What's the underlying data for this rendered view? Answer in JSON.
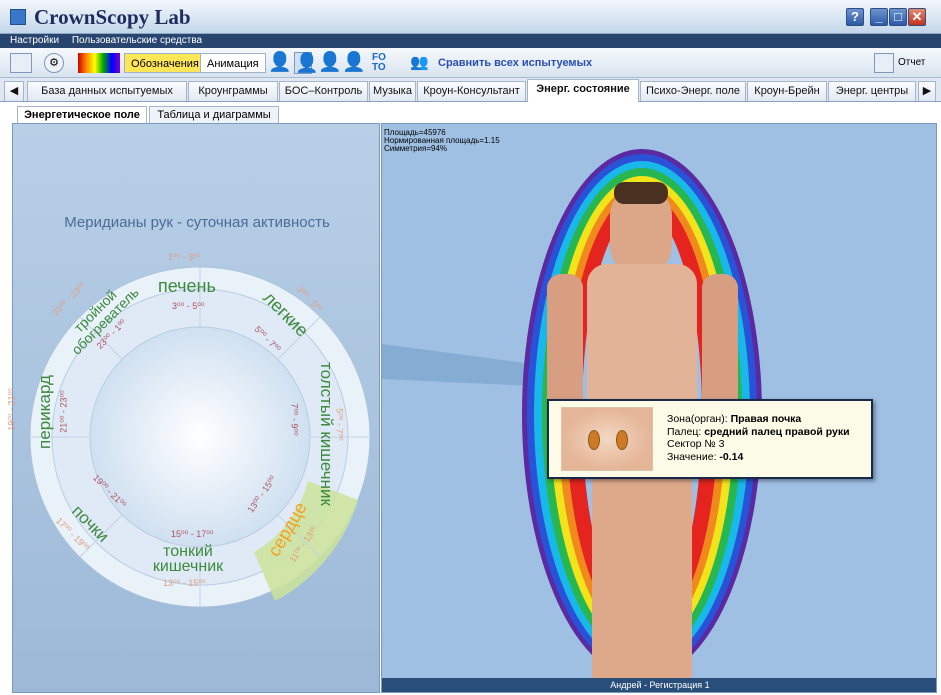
{
  "app": {
    "title": "CrownScopy Lab",
    "help": "?",
    "minimize": "_",
    "restore": "□",
    "close": "✕"
  },
  "menu": {
    "items": [
      "Настройки",
      "Пользовательские средства"
    ]
  },
  "toolbar": {
    "designations": "Обозначения",
    "animation": "Анимация",
    "foto": "FO\nTO",
    "compare": "Сравнить всех испытуемых",
    "report": "Отчет"
  },
  "tabs": [
    "База данных испытуемых",
    "Кроунграммы",
    "БОС–Контроль",
    "Музыка",
    "Кроун-Консультант",
    "Энерг. состояние",
    "Психо-Энерг. поле",
    "Кроун-Брейн",
    "Энерг. центры"
  ],
  "subtabs": [
    "Энергетическое поле",
    "Таблица и диаграммы"
  ],
  "left": {
    "title": "Меридианы рук - суточная активность"
  },
  "wheel": {
    "organs": [
      {
        "label": "печень",
        "time": "1⁰⁰ - 3⁰⁰",
        "inner": "3⁰⁰ - 5⁰⁰"
      },
      {
        "label": "легкие",
        "time": "3⁰⁰ - 5⁰⁰",
        "inner": "5⁰⁰ - 7⁰⁰"
      },
      {
        "label": "толстый кишечник",
        "time": "5⁰⁰ - 7⁰⁰",
        "inner": "7⁰⁰ - 9⁰⁰"
      },
      {
        "label": "сердце",
        "time": "11⁰⁰ - 13⁰⁰",
        "inner": "13⁰⁰ - 15⁰⁰"
      },
      {
        "label": "тонкий кишечник",
        "time": "13⁰⁰ - 15⁰⁰",
        "inner": "15⁰⁰ - 17⁰⁰"
      },
      {
        "label": "почки",
        "time": "17⁰⁰ - 19⁰⁰",
        "inner": "19⁰⁰ - 21⁰⁰"
      },
      {
        "label": "перикард",
        "time": "19⁰⁰ - 21⁰⁰",
        "inner": "21⁰⁰ - 23⁰⁰"
      },
      {
        "label": "тройной обогреватель",
        "time": "21⁰⁰ - 23⁰⁰",
        "inner": "23⁰⁰ - 1⁰⁰"
      }
    ]
  },
  "stats": {
    "area": "Площадь=45976",
    "normalized": "Нормированная площадь=1.15",
    "symmetry": "Симметрия=94%"
  },
  "tooltip": {
    "zone_label": "Зона(орган): ",
    "zone_value": "Правая почка",
    "finger_label": "Палец: ",
    "finger_value": "средний палец правой руки",
    "sector": "Сектор № 3",
    "value_label": "Значение: ",
    "value": "-0.14"
  },
  "status": "Андрей - Регистрация 1"
}
